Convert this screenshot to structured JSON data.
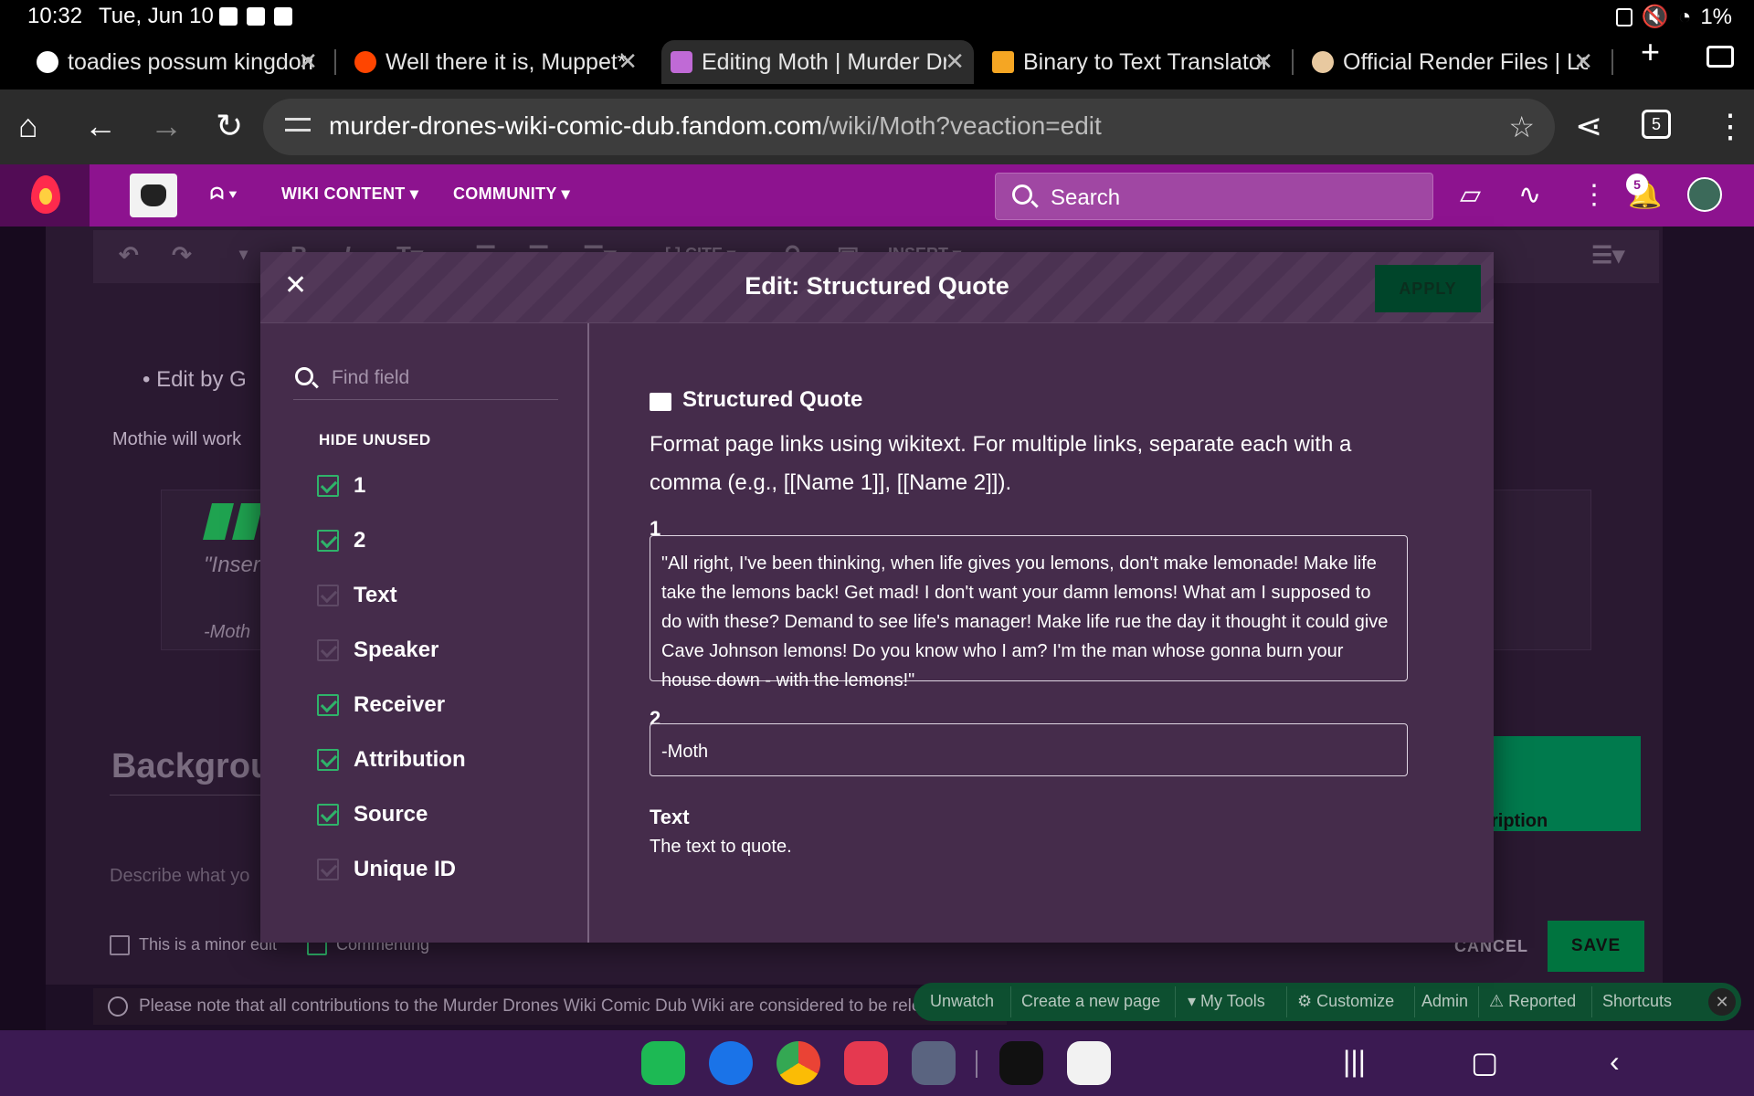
{
  "status_bar": {
    "time": "10:32",
    "date": "Tue, Jun 10",
    "battery": "1%"
  },
  "tabs": [
    {
      "title": "toadies possum kingdom",
      "active": false
    },
    {
      "title": "Well there it is, Muppet*",
      "active": false
    },
    {
      "title": "Editing Moth | Murder Dr",
      "active": true
    },
    {
      "title": "Binary to Text Translator",
      "active": false
    },
    {
      "title": "Official Render Files | Lo",
      "active": false
    }
  ],
  "address_bar": {
    "url_host": "murder-drones-wiki-comic-dub.fandom.com",
    "url_path": "/wiki/Moth?veaction=edit",
    "tab_count": "5"
  },
  "fandom_header": {
    "nav": [
      "WIKI CONTENT",
      "COMMUNITY"
    ],
    "search_placeholder": "Search",
    "notification_count": "5"
  },
  "background_page": {
    "bullet_text": "Edit by G",
    "body_text": "Mothie will work",
    "quote_text": "\"Inser",
    "quote_attr": "-Moth",
    "heading": "Backgrou",
    "describe_placeholder": "Describe what yo",
    "minor_edit_label": "This is a minor edit",
    "commenting_label": "Commenting",
    "green_box_text": "ription",
    "cancel_label": "CANCEL",
    "save_label": "SAVE",
    "notice": "Please note that all contributions to the Murder Drones Wiki Comic Dub Wiki are considered to be releas"
  },
  "toolbar": {
    "cite": "CITE",
    "insert": "INSERT"
  },
  "tools_bar": [
    "Unwatch",
    "Create a new page",
    "My Tools",
    "Customize",
    "Admin",
    "Reported",
    "Shortcuts"
  ],
  "modal": {
    "title": "Edit: Structured Quote",
    "apply_label": "APPLY",
    "find_placeholder": "Find field",
    "hide_unused_label": "HIDE UNUSED",
    "fields": [
      {
        "label": "1",
        "checked": true
      },
      {
        "label": "2",
        "checked": true
      },
      {
        "label": "Text",
        "checked": false
      },
      {
        "label": "Speaker",
        "checked": false
      },
      {
        "label": "Receiver",
        "checked": true
      },
      {
        "label": "Attribution",
        "checked": true
      },
      {
        "label": "Source",
        "checked": true
      },
      {
        "label": "Unique ID",
        "checked": false
      }
    ],
    "template_title": "Structured Quote",
    "template_description": "Format page links using wikitext. For multiple links, separate each with a comma (e.g., [[Name 1]], [[Name 2]]).",
    "params": [
      {
        "label": "1",
        "value": "\"All right, I've been thinking, when life gives you lemons, don't make lemonade! Make life take the lemons back! Get mad! I don't want your damn lemons! What am I supposed to do with these? Demand to see life's manager! Make life rue the day it thought it could give Cave Johnson lemons! Do you know who I am? I'm the man whose gonna burn your house down - with the lemons!\""
      },
      {
        "label": "2",
        "value": "-Moth"
      }
    ],
    "text_param_label": "Text",
    "text_param_help": "The text to quote."
  },
  "colors": {
    "fandom_purple": "#8d138f",
    "accent_green": "#2fb36a",
    "modal_bg": "#452c4b",
    "android_nav": "#3b1a52"
  }
}
